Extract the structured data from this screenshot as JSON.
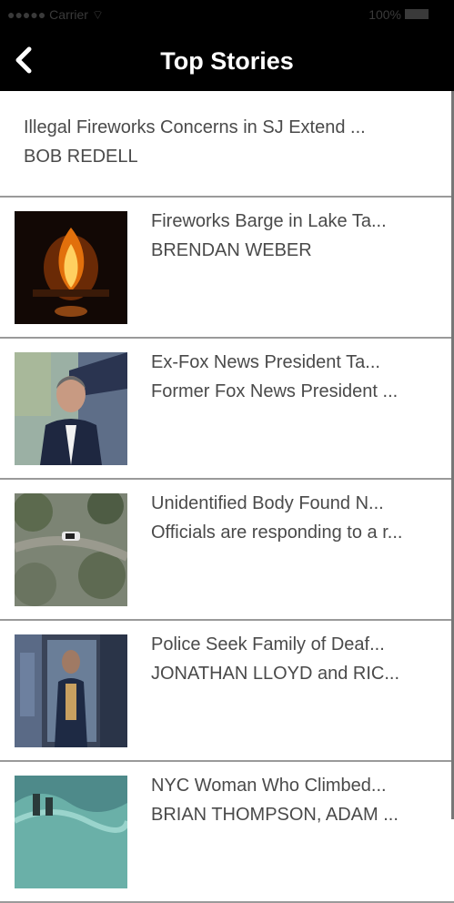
{
  "status_bar": {
    "carrier": "●●●●● Carrier ⌔",
    "battery": "100%"
  },
  "header": {
    "title": "Top Stories",
    "back_icon": "chevron-left-icon"
  },
  "top_story": {
    "title": "Illegal Fireworks Concerns in SJ Extend ...",
    "subtitle": "BOB REDELL"
  },
  "stories": [
    {
      "title": "Fireworks Barge in Lake Ta...",
      "subtitle": "BRENDAN WEBER",
      "thumb": "fireworks-fire-thumbnail"
    },
    {
      "title": "Ex-Fox News President Ta...",
      "subtitle": "Former Fox News President ...",
      "thumb": "man-in-suit-thumbnail"
    },
    {
      "title": "Unidentified Body Found N...",
      "subtitle": "Officials are responding to a r...",
      "thumb": "aerial-scene-thumbnail"
    },
    {
      "title": "Police Seek Family of Deaf...",
      "subtitle": "JONATHAN LLOYD and RIC...",
      "thumb": "police-scene-thumbnail"
    },
    {
      "title": "NYC Woman Who Climbed...",
      "subtitle": "BRIAN THOMPSON, ADAM ...",
      "thumb": "nyc-water-thumbnail"
    }
  ]
}
